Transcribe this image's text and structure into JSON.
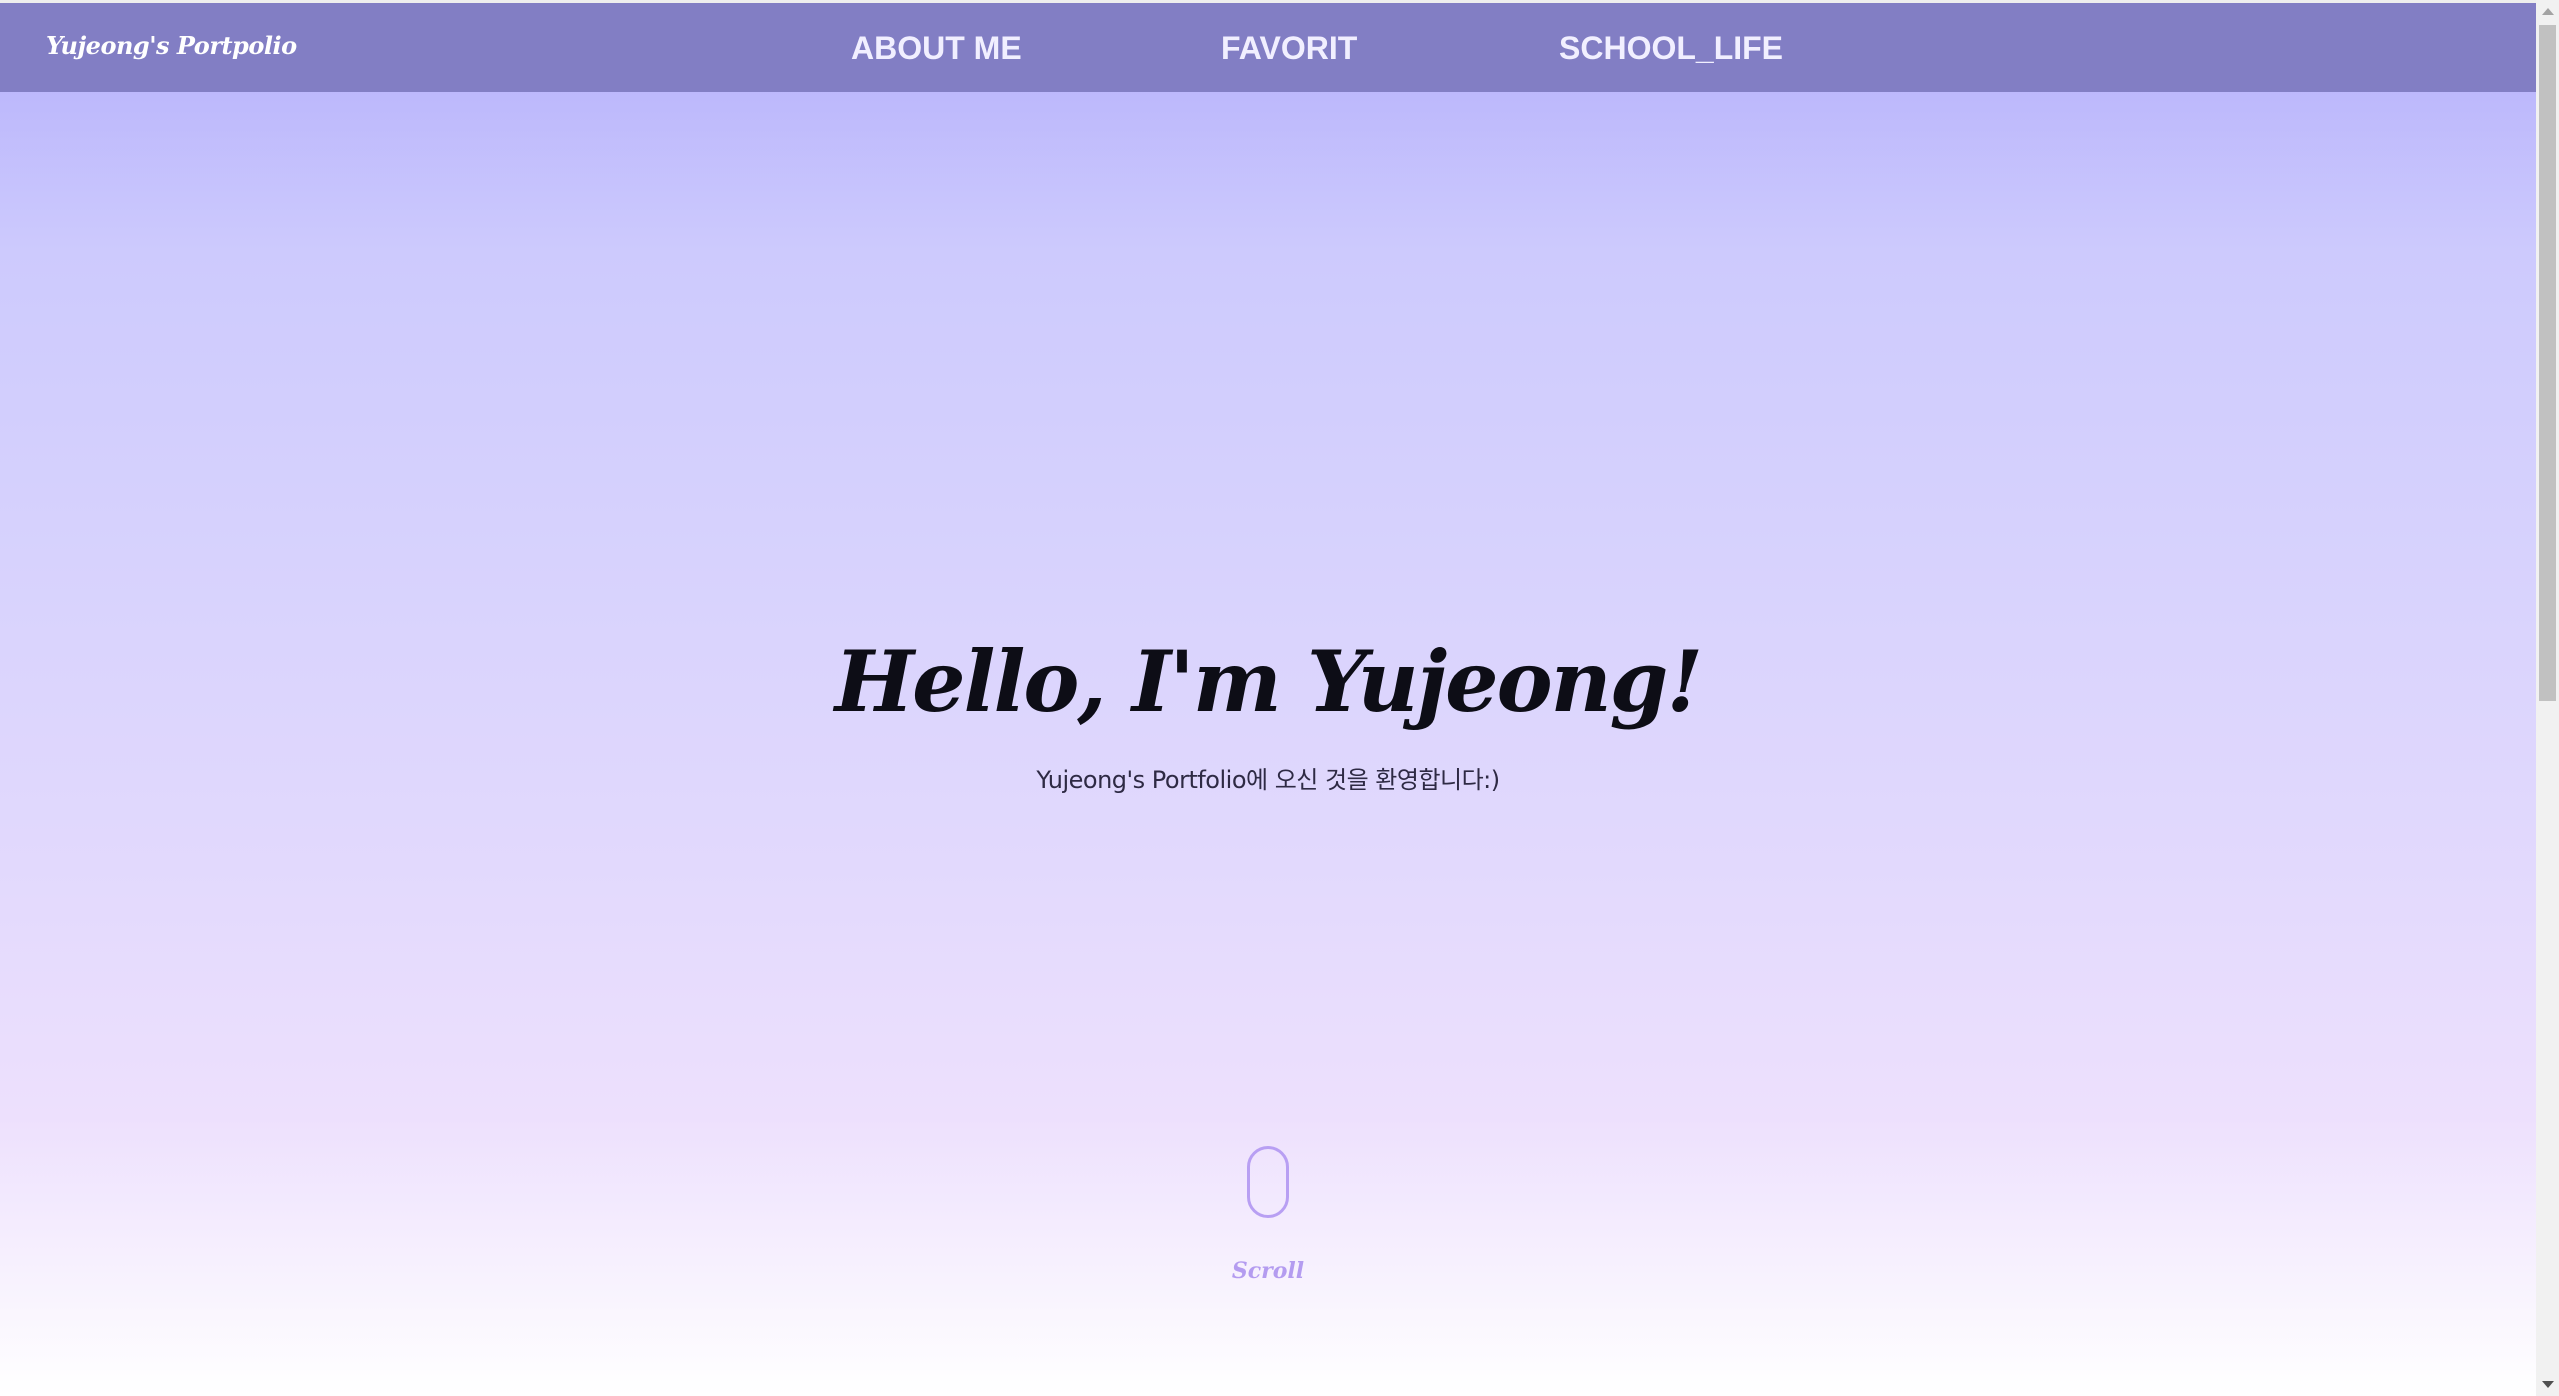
{
  "header": {
    "logo": "Yujeong's Portpolio",
    "nav": [
      {
        "label": "ABOUT ME"
      },
      {
        "label": "FAVORIT"
      },
      {
        "label": "SCHOOL_LIFE"
      }
    ]
  },
  "hero": {
    "title": "Hello, I'm Yujeong!",
    "subtitle": "Yujeong's Portfolio에 오신 것을 환영합니다:)"
  },
  "scroll_hint": {
    "label": "Scroll",
    "icon": "mouse-icon"
  },
  "colors": {
    "navbar": "#827ec4",
    "gradient_top": "#b3aefc",
    "gradient_bottom": "#ffffff",
    "accent": "#b89ff3"
  }
}
